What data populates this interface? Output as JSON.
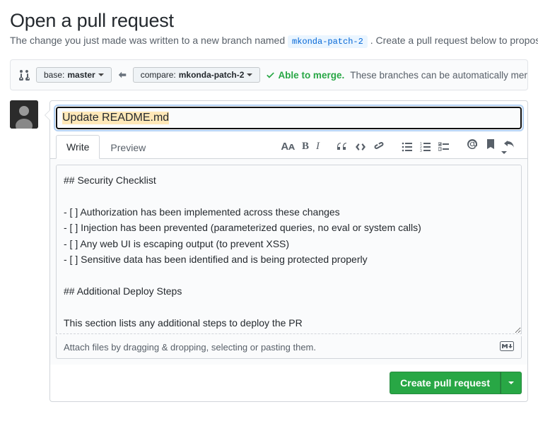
{
  "header": {
    "title": "Open a pull request",
    "subtitle_pre": "The change you just made was written to a new branch named ",
    "branch_name": "mkonda-patch-2",
    "subtitle_post": ". Create a pull request below to propose these changes."
  },
  "compare": {
    "base_label": "base: ",
    "base_branch": "master",
    "compare_label": "compare: ",
    "compare_branch": "mkonda-patch-2",
    "merge_ok": "Able to merge.",
    "merge_info": "These branches can be automatically merged."
  },
  "form": {
    "title_value": "Update README.md",
    "tab_write": "Write",
    "tab_preview": "Preview",
    "body_value": "## Security Checklist\n\n- [ ] Authorization has been implemented across these changes\n- [ ] Injection has been prevented (parameterized queries, no eval or system calls)\n- [ ] Any web UI is escaping output (to prevent XSS)\n- [ ] Sensitive data has been identified and is being protected properly\n\n## Additional Deploy Steps\n\nThis section lists any additional steps to deploy the PR",
    "attach_hint": "Attach files by dragging & dropping, selecting or pasting them.",
    "submit_label": "Create pull request"
  },
  "toolbar_icons": {
    "text_size": "Aᴀ",
    "bold": "B",
    "italic": "I"
  }
}
